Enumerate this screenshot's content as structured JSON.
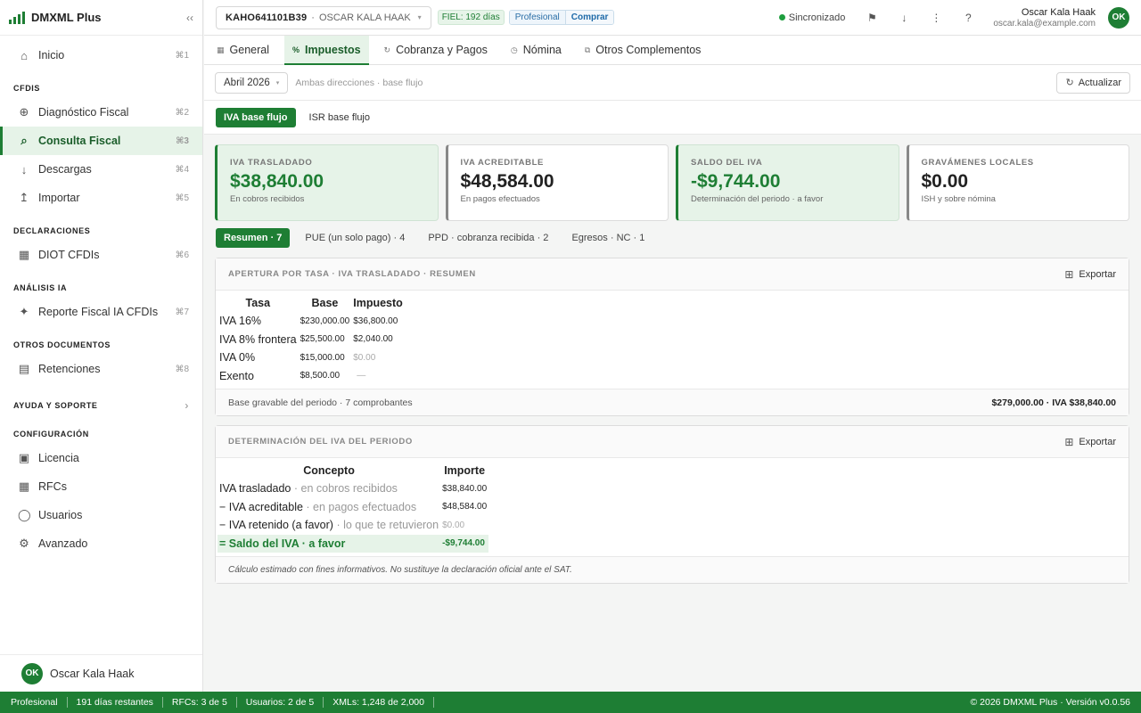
{
  "app": {
    "name": "DMXML Plus",
    "collapse_glyph": "‹‹"
  },
  "sidebar": {
    "home": {
      "label": "Inicio",
      "shortcut": "⌘1",
      "icon": "home-icon"
    },
    "sections": [
      {
        "title": "CFDIS",
        "items": [
          {
            "label": "Diagnóstico Fiscal",
            "shortcut": "⌘2",
            "icon": "plus-circle-icon"
          },
          {
            "label": "Consulta Fiscal",
            "shortcut": "⌘3",
            "icon": "search-icon",
            "active": true
          },
          {
            "label": "Descargas",
            "shortcut": "⌘4",
            "icon": "download-icon"
          },
          {
            "label": "Importar",
            "shortcut": "⌘5",
            "icon": "upload-icon"
          }
        ]
      },
      {
        "title": "DECLARACIONES",
        "items": [
          {
            "label": "DIOT CFDIs",
            "shortcut": "⌘6",
            "icon": "grid-icon"
          }
        ]
      },
      {
        "title": "ANÁLISIS IA",
        "items": [
          {
            "label": "Reporte Fiscal IA CFDIs",
            "shortcut": "⌘7",
            "icon": "sparkle-icon"
          }
        ]
      },
      {
        "title": "OTROS DOCUMENTOS",
        "items": [
          {
            "label": "Retenciones",
            "shortcut": "⌘8",
            "icon": "list-icon"
          }
        ]
      }
    ],
    "help": {
      "title": "AYUDA Y SOPORTE",
      "chevron": "›"
    },
    "config": {
      "title": "CONFIGURACIÓN",
      "items": [
        {
          "label": "Licencia",
          "icon": "license-icon"
        },
        {
          "label": "RFCs",
          "icon": "grid-icon"
        },
        {
          "label": "Usuarios",
          "icon": "user-circle-icon"
        },
        {
          "label": "Avanzado",
          "icon": "gear-icon"
        }
      ]
    },
    "user": {
      "initials": "OK",
      "name": "Oscar Kala Haak"
    }
  },
  "topbar": {
    "rfc": "KAHO641101B39",
    "separator": "·",
    "rfc_name": "OSCAR KALA HAAK",
    "fiel": "FIEL: 192 días",
    "plan": "Profesional",
    "buy": "Comprar",
    "sync": "Sincronizado",
    "user_name": "Oscar Kala Haak",
    "user_email": "oscar.kala@example.com",
    "initials": "OK"
  },
  "tabs": [
    {
      "label": "General",
      "icon": "grid-icon",
      "glyph": "▦"
    },
    {
      "label": "Impuestos",
      "icon": "percent-icon",
      "glyph": "%",
      "active": true
    },
    {
      "label": "Cobranza y Pagos",
      "icon": "refresh-icon",
      "glyph": "↻"
    },
    {
      "label": "Nómina",
      "icon": "clock-icon",
      "glyph": "◷"
    },
    {
      "label": "Otros Complementos",
      "icon": "copy-icon",
      "glyph": "⧉"
    }
  ],
  "filter": {
    "period": "Abril 2026",
    "hint": "Ambas direcciones · base flujo",
    "refresh": "Actualizar"
  },
  "segments": [
    {
      "label": "IVA base flujo",
      "active": true
    },
    {
      "label": "ISR base flujo"
    }
  ],
  "cards": [
    {
      "label": "IVA TRASLADADO",
      "value": "$38,840.00",
      "sub": "En cobros recibidos",
      "style": "green"
    },
    {
      "label": "IVA ACREDITABLE",
      "value": "$48,584.00",
      "sub": "En pagos efectuados",
      "style": "plain"
    },
    {
      "label": "SALDO DEL IVA",
      "value": "-$9,744.00",
      "sub": "Determinación del periodo · a favor",
      "style": "green"
    },
    {
      "label": "GRAVÁMENES LOCALES",
      "value": "$0.00",
      "sub": "ISH y sobre nómina",
      "style": "plain"
    }
  ],
  "chips": [
    {
      "label": "Resumen · 7",
      "active": true
    },
    {
      "label": "PUE (un solo pago) · 4"
    },
    {
      "label": "PPD · cobranza recibida · 2"
    },
    {
      "label": "Egresos · NC · 1"
    }
  ],
  "panel1": {
    "title": "APERTURA POR TASA · IVA TRASLADADO · RESUMEN",
    "export": "Exportar",
    "headers": [
      "Tasa",
      "Base",
      "Impuesto"
    ],
    "rows": [
      {
        "tasa": "IVA 16%",
        "base": "$230,000.00",
        "impuesto": "$36,800.00"
      },
      {
        "tasa": "IVA 8% frontera",
        "base": "$25,500.00",
        "impuesto": "$2,040.00"
      },
      {
        "tasa": "IVA 0%",
        "base": "$15,000.00",
        "impuesto": "$0.00",
        "muted": true
      },
      {
        "tasa": "Exento",
        "base": "$8,500.00",
        "impuesto": "—",
        "muted": true
      }
    ],
    "footer_left": "Base gravable del periodo · 7 comprobantes",
    "footer_right": "$279,000.00 · IVA $38,840.00"
  },
  "panel2": {
    "title": "DETERMINACIÓN DEL IVA DEL PERIODO",
    "export": "Exportar",
    "headers": [
      "Concepto",
      "Importe"
    ],
    "rows": [
      {
        "concepto": "IVA trasladado",
        "detalle": " · en cobros recibidos",
        "importe": "$38,840.00"
      },
      {
        "concepto": "− IVA acreditable",
        "detalle": " · en pagos efectuados",
        "importe": "$48,584.00"
      },
      {
        "concepto": "− IVA retenido (a favor)",
        "detalle": " · lo que te retuvieron",
        "importe": "$0.00",
        "muted": true
      },
      {
        "concepto": "= Saldo del IVA · a favor",
        "detalle": "",
        "importe": "-$9,744.00",
        "highlight": true
      }
    ],
    "note": "Cálculo estimado con fines informativos. No sustituye la declaración oficial ante el SAT."
  },
  "statusbar": {
    "items": [
      "Profesional",
      "191 días restantes",
      "RFCs: 3 de 5",
      "Usuarios: 2 de 5",
      "XMLs: 1,248 de 2,000"
    ],
    "copyright": "© 2026 DMXML Plus · Versión v0.0.56"
  },
  "colors": {
    "accent": "#1e7e34",
    "accent_light": "#e6f3e8",
    "plan_blue": "#2a6ea6"
  }
}
